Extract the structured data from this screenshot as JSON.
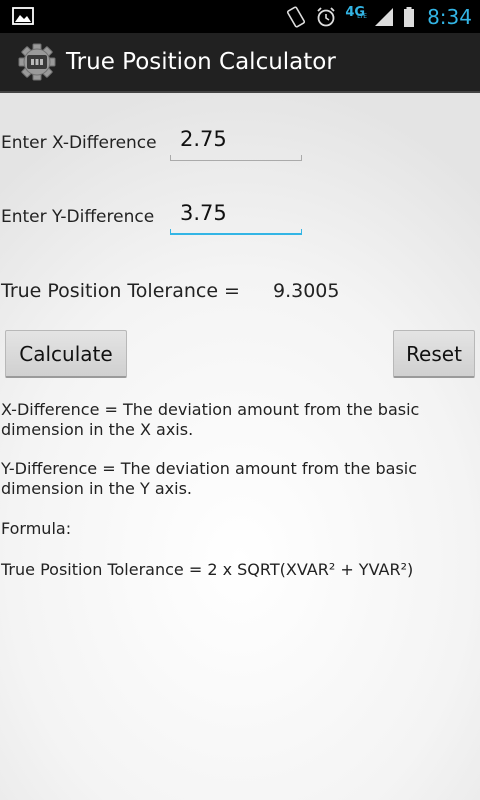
{
  "status_bar": {
    "time": "8:34",
    "network": "4G",
    "network_sub": "LTE",
    "icons": [
      "image-icon",
      "rotation-lock-icon",
      "alarm-icon",
      "signal-icon",
      "battery-icon"
    ]
  },
  "action_bar": {
    "title": "True Position Calculator",
    "icon": "gear-icon"
  },
  "form": {
    "x_label": "Enter X-Difference",
    "x_value": "2.75",
    "y_label": "Enter Y-Difference",
    "y_value": "3.75"
  },
  "result": {
    "label": "True Position Tolerance =",
    "value": "9.3005"
  },
  "buttons": {
    "calculate": "Calculate",
    "reset": "Reset"
  },
  "info": {
    "x_desc": "X-Difference = The deviation amount from the basic dimension in the X axis.",
    "y_desc": "Y-Difference = The deviation amount from the basic dimension in the Y axis.",
    "formula_label": "Formula:",
    "formula": "True Position Tolerance = 2 x  SQRT(XVAR² + YVAR²)"
  },
  "colors": {
    "accent": "#33b5e5",
    "action_bar": "#212121",
    "status_bar": "#000000"
  }
}
